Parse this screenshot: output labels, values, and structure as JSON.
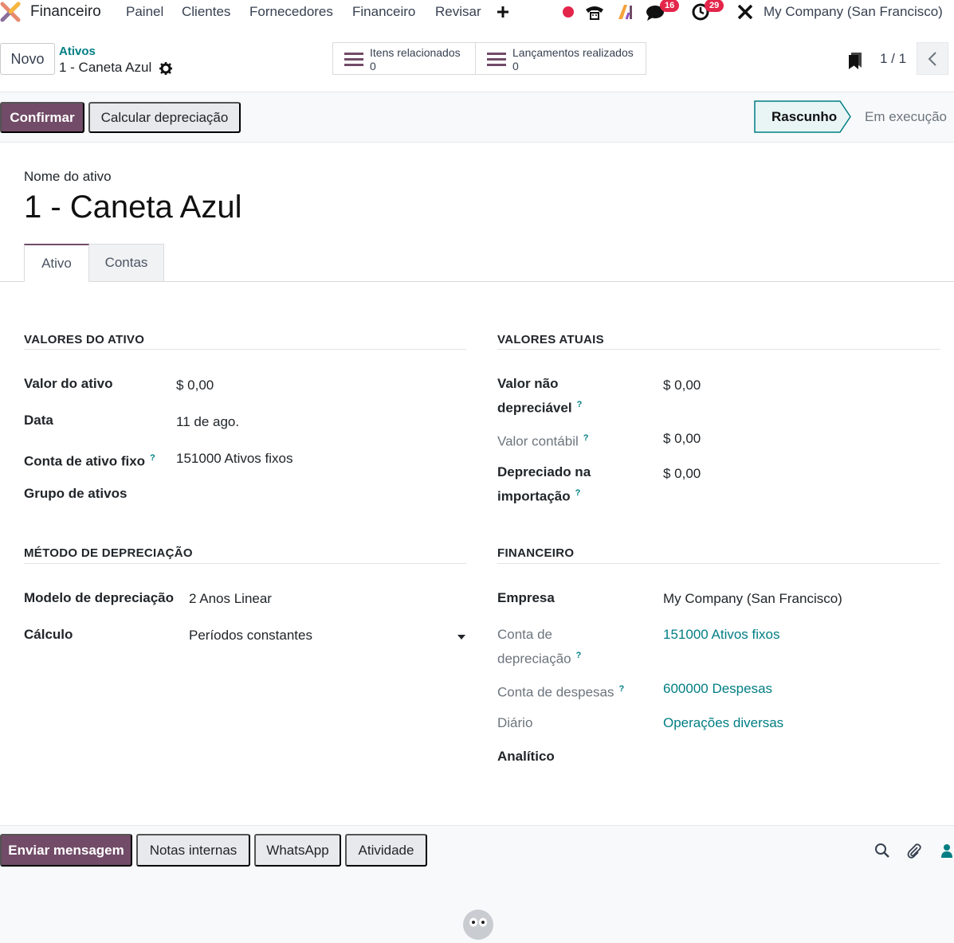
{
  "nav": {
    "app_name": "Financeiro",
    "menu": [
      "Painel",
      "Clientes",
      "Fornecedores",
      "Financeiro",
      "Revisar"
    ],
    "messages_badge": "16",
    "activities_badge": "29",
    "company": "My Company (San Francisco)"
  },
  "control_panel": {
    "new_button": "Novo",
    "breadcrumb_parent": "Ativos",
    "breadcrumb_current": "1 - Caneta Azul",
    "smart_buttons": [
      {
        "label": "Itens relacionados",
        "value": "0"
      },
      {
        "label": "Lançamentos realizados",
        "value": "0"
      }
    ],
    "pager": "1 / 1"
  },
  "statusbar": {
    "confirm_button": "Confirmar",
    "compute_button": "Calcular depreciação",
    "stages": [
      "Rascunho",
      "Em execução"
    ],
    "current_stage": "Rascunho"
  },
  "form": {
    "name_label": "Nome do ativo",
    "name": "1 - Caneta Azul",
    "tabs": [
      "Ativo",
      "Contas"
    ],
    "sections": {
      "asset_values": {
        "title": "VALORES DO ATIVO",
        "fields": [
          {
            "label": "Valor do ativo",
            "value": "$ 0,00"
          },
          {
            "label": "Data",
            "value": "11 de ago."
          },
          {
            "label": "Conta de ativo fixo",
            "value": "151000 Ativos fixos"
          },
          {
            "label": "Grupo de ativos",
            "value": ""
          }
        ]
      },
      "current_values": {
        "title": "VALORES ATUAIS",
        "fields": [
          {
            "label_l1": "Valor não",
            "label_l2": "depreciável",
            "value": "$ 0,00"
          },
          {
            "label": "Valor contábil",
            "value": "$ 0,00"
          },
          {
            "label_l1": "Depreciado na",
            "label_l2": "importação",
            "value": "$ 0,00"
          }
        ]
      },
      "depreciation_method": {
        "title": "MÉTODO DE DEPRECIAÇÃO",
        "fields": [
          {
            "label": "Modelo de depreciação",
            "value": "2 Anos Linear"
          },
          {
            "label": "Cálculo",
            "value": "Períodos constantes"
          }
        ]
      },
      "financial": {
        "title": "FINANCEIRO",
        "fields": [
          {
            "label": "Empresa",
            "value": "My Company (San Francisco)"
          },
          {
            "label_l1": "Conta de",
            "label_l2": "depreciação",
            "value": "151000 Ativos fixos"
          },
          {
            "label": "Conta de despesas",
            "value": "600000 Despesas"
          },
          {
            "label": "Diário",
            "value": "Operações diversas"
          },
          {
            "label": "Analítico",
            "value": ""
          }
        ]
      }
    },
    "help_mark": "?"
  },
  "chatter": {
    "send_message": "Enviar mensagem",
    "internal_notes": "Notas internas",
    "whatsapp": "WhatsApp",
    "activity": "Atividade"
  },
  "colors": {
    "primary": "#714b67",
    "link": "#017e84",
    "badge": "#e4254a"
  }
}
